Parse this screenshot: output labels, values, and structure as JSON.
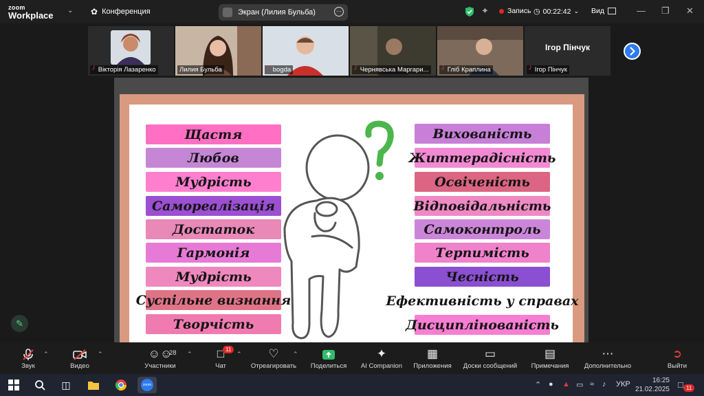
{
  "app": {
    "logo_line1": "zoom",
    "logo_line2": "Workplace",
    "conference_label": "Конференция"
  },
  "share_pill": {
    "label": "Экран (Лилия Бульба)"
  },
  "status": {
    "record_label": "Запись",
    "timer": "00:22:42",
    "view_label": "Вид"
  },
  "participants": [
    {
      "name": "Вікторія Лазаренко",
      "muted": true
    },
    {
      "name": "Лилия Бульба",
      "muted": false
    },
    {
      "name": "bogda",
      "muted": true
    },
    {
      "name": "Чернявська Маргари...",
      "muted": true
    },
    {
      "name": "Гліб Краплина",
      "muted": true
    },
    {
      "name": "Ігор Пінчук",
      "muted": true,
      "display_name": "Ігор Пінчук"
    }
  ],
  "slide": {
    "left_words": [
      {
        "text": "Щастя",
        "color": "#ff6fc2"
      },
      {
        "text": "Любов",
        "color": "#c586d6"
      },
      {
        "text": "Мудрість",
        "color": "#ff7fcf"
      },
      {
        "text": "Самореалізація",
        "color": "#9b4fd1"
      },
      {
        "text": "Достаток",
        "color": "#e889b8"
      },
      {
        "text": "Гармонія",
        "color": "#e77ad6"
      },
      {
        "text": "Мудрість",
        "color": "#ee88bd"
      },
      {
        "text": "Суспільне визнання",
        "color": "#e07487"
      },
      {
        "text": "Творчість",
        "color": "#f07bb0"
      }
    ],
    "right_words": [
      {
        "text": "Вихованість",
        "color": "#c77fd8"
      },
      {
        "text": "Життерадісність",
        "color": "#f18ad3"
      },
      {
        "text": "Освіченість",
        "color": "#db6583"
      },
      {
        "text": "Відповідальність",
        "color": "#ee89c4"
      },
      {
        "text": "Самоконтроль",
        "color": "#cc86d9"
      },
      {
        "text": "Терпимість",
        "color": "#f082cc"
      },
      {
        "text": "Чесність",
        "color": "#8b4fd1"
      },
      {
        "text": "Ефективність у справах",
        "color": "#ffffff"
      },
      {
        "text": "Дисциплінованість",
        "color": "#f77ed2"
      }
    ]
  },
  "toolbar": {
    "audio": "Звук",
    "video": "Видео",
    "participants": "Участники",
    "participants_count": "28",
    "chat": "Чат",
    "chat_badge": "11",
    "react": "Отреагировать",
    "share": "Поделиться",
    "ai": "AI Companion",
    "apps": "Приложения",
    "boards": "Доски сообщений",
    "notes": "Примечания",
    "more": "Дополнительно",
    "leave": "Выйти"
  },
  "taskbar": {
    "lang": "УКР",
    "time": "16:25",
    "date": "21.02.2025",
    "notif_count": "11"
  },
  "colors": {
    "accent_green": "#2fbd6b",
    "accent_blue": "#2d7bf0",
    "record_red": "#e02828"
  }
}
